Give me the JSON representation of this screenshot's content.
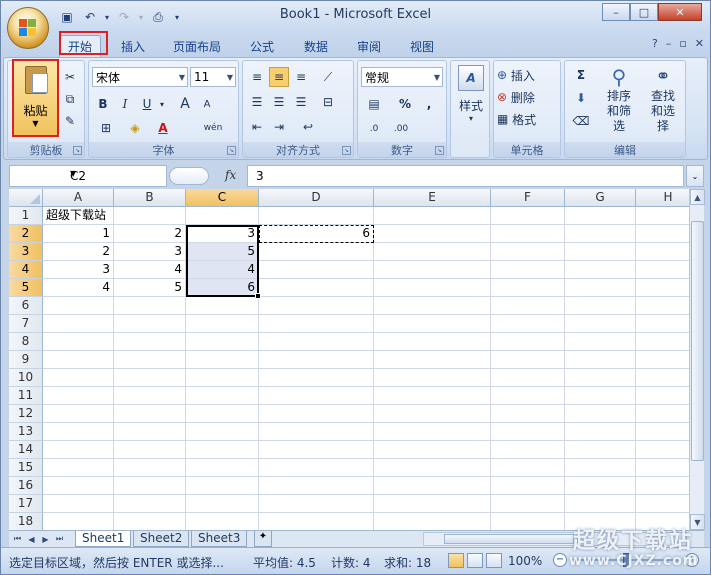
{
  "app": {
    "title": "Book1 - Microsoft Excel",
    "window_controls": {
      "minimize": "–",
      "restore": "□",
      "close": "✕"
    }
  },
  "quick_access": {
    "save_icon": "save-icon",
    "undo_icon": "undo-icon",
    "redo_icon": "redo-icon",
    "print_preview_icon": "print-preview-icon",
    "customize_icon": "customize-dropdown-icon"
  },
  "ribbon_tabs": [
    "开始",
    "插入",
    "页面布局",
    "公式",
    "数据",
    "审阅",
    "视图"
  ],
  "ribbon_right": {
    "help": "?",
    "minimize": "–",
    "restore": "▫",
    "close": "✕"
  },
  "clipboard": {
    "paste_label": "粘贴",
    "group_label": "剪贴板"
  },
  "font": {
    "name": "宋体",
    "size": "11",
    "bold": "B",
    "italic": "I",
    "underline": "U",
    "grow": "A",
    "shrink": "A",
    "phonetic": "wén",
    "group_label": "字体"
  },
  "alignment": {
    "group_label": "对齐方式"
  },
  "number": {
    "format": "常规",
    "percent": "%",
    "comma": ",",
    "inc_decimal": ".0",
    "dec_decimal": ".00",
    "group_label": "数字"
  },
  "styles": {
    "label": "样式"
  },
  "cells": {
    "insert": "插入",
    "delete": "删除",
    "format": "格式",
    "group_label": "单元格"
  },
  "editing": {
    "sum": "Σ",
    "sort_filter": "排序和筛选",
    "find_select": "查找和选择",
    "group_label": "编辑"
  },
  "formula_bar": {
    "name_box": "C2",
    "fx": "fx",
    "value": "3"
  },
  "columns": [
    "A",
    "B",
    "C",
    "D",
    "E",
    "F",
    "G",
    "H"
  ],
  "rows": [
    "1",
    "2",
    "3",
    "4",
    "5",
    "6",
    "7",
    "8",
    "9",
    "10",
    "11",
    "12",
    "13",
    "14",
    "15",
    "16",
    "17",
    "18"
  ],
  "cells_data": {
    "A1": "超级下载站",
    "A2": "1",
    "B2": "2",
    "C2": "3",
    "D2": "6",
    "A3": "2",
    "B3": "3",
    "C3": "5",
    "A4": "3",
    "B4": "4",
    "C4": "4",
    "A5": "4",
    "B5": "5",
    "C5": "6"
  },
  "sheet_tabs": [
    "Sheet1",
    "Sheet2",
    "Sheet3"
  ],
  "status": {
    "message": "选定目标区域，然后按 ENTER 或选择...",
    "average": "平均值: 4.5",
    "count": "计数: 4",
    "sum": "求和: 18",
    "zoom": "100%",
    "zoom_minus": "−",
    "zoom_plus": "+"
  },
  "watermark": {
    "line1": "超级下载站",
    "line2": "www.CJXZ.com"
  }
}
